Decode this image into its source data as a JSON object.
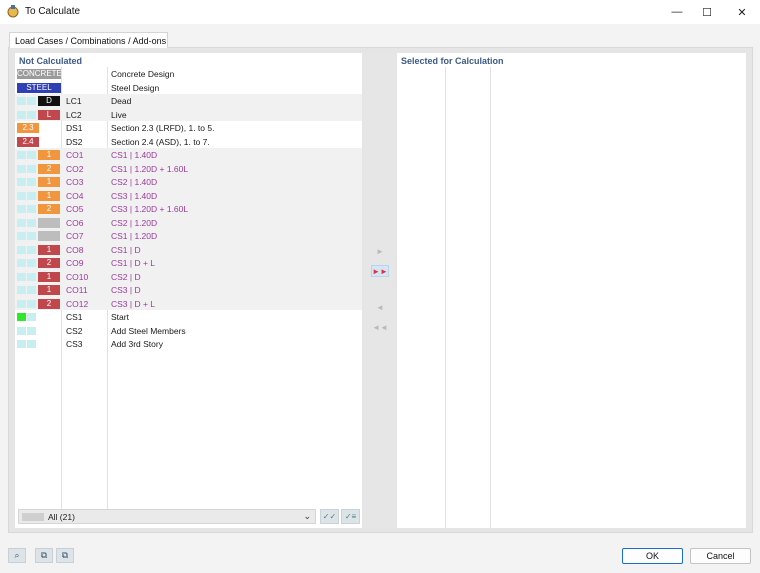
{
  "window": {
    "title": "To Calculate",
    "minimize": "—",
    "maximize": "☐",
    "close": "✕"
  },
  "tab": {
    "label": "Load Cases / Combinations / Add-ons"
  },
  "left_panel": {
    "title": "Not Calculated",
    "rows": [
      {
        "tag": "CONCRETE",
        "tag_color": "#9b9b9b",
        "tag_kind": "wide",
        "sq1": false,
        "sq2": false,
        "id": "",
        "desc": "Concrete Design",
        "purple": false
      },
      {
        "tag": "STEEL",
        "tag_color": "#2f3fb4",
        "tag_kind": "wide",
        "sq1": false,
        "sq2": false,
        "id": "",
        "desc": "Steel Design",
        "purple": false
      },
      {
        "tag": "D",
        "tag_color": "#111111",
        "tag_kind": "col2",
        "sq1": true,
        "sq2": true,
        "id": "LC1",
        "desc": "Dead",
        "purple": false
      },
      {
        "tag": "L",
        "tag_color": "#c0474b",
        "tag_kind": "col2",
        "sq1": true,
        "sq2": true,
        "id": "LC2",
        "desc": "Live",
        "purple": false
      },
      {
        "tag": "2.3",
        "tag_color": "#f0963f",
        "tag_kind": "col1",
        "sq1": false,
        "sq2": false,
        "id": "DS1",
        "desc": "Section 2.3 (LRFD), 1. to 5.",
        "purple": false
      },
      {
        "tag": "2.4",
        "tag_color": "#c0474b",
        "tag_kind": "col1",
        "sq1": false,
        "sq2": false,
        "id": "DS2",
        "desc": "Section 2.4 (ASD), 1. to 7.",
        "purple": false
      },
      {
        "tag": "1",
        "tag_color": "#f0963f",
        "tag_kind": "col2",
        "sq1": true,
        "sq2": true,
        "id": "CO1",
        "desc": "CS1 | 1.40D",
        "purple": true
      },
      {
        "tag": "2",
        "tag_color": "#f0963f",
        "tag_kind": "col2",
        "sq1": true,
        "sq2": true,
        "id": "CO2",
        "desc": "CS1 | 1.20D + 1.60L",
        "purple": true
      },
      {
        "tag": "1",
        "tag_color": "#f0963f",
        "tag_kind": "col2",
        "sq1": true,
        "sq2": true,
        "id": "CO3",
        "desc": "CS2 | 1.40D",
        "purple": true
      },
      {
        "tag": "1",
        "tag_color": "#f0963f",
        "tag_kind": "col2",
        "sq1": true,
        "sq2": true,
        "id": "CO4",
        "desc": "CS3 | 1.40D",
        "purple": true
      },
      {
        "tag": "2",
        "tag_color": "#f0963f",
        "tag_kind": "col2",
        "sq1": true,
        "sq2": true,
        "id": "CO5",
        "desc": "CS3 | 1.20D + 1.60L",
        "purple": true
      },
      {
        "tag": "",
        "tag_color": "#bdbdbd",
        "tag_kind": "col2",
        "sq1": true,
        "sq2": true,
        "id": "CO6",
        "desc": "CS2 | 1.20D",
        "purple": true
      },
      {
        "tag": "",
        "tag_color": "#bdbdbd",
        "tag_kind": "col2",
        "sq1": true,
        "sq2": true,
        "id": "CO7",
        "desc": "CS1 | 1.20D",
        "purple": true
      },
      {
        "tag": "1",
        "tag_color": "#c0474b",
        "tag_kind": "col2",
        "sq1": true,
        "sq2": true,
        "id": "CO8",
        "desc": "CS1 | D",
        "purple": true
      },
      {
        "tag": "2",
        "tag_color": "#c0474b",
        "tag_kind": "col2",
        "sq1": true,
        "sq2": true,
        "id": "CO9",
        "desc": "CS1 | D + L",
        "purple": true
      },
      {
        "tag": "1",
        "tag_color": "#c0474b",
        "tag_kind": "col2",
        "sq1": true,
        "sq2": true,
        "id": "CO10",
        "desc": "CS2 | D",
        "purple": true
      },
      {
        "tag": "1",
        "tag_color": "#c0474b",
        "tag_kind": "col2",
        "sq1": true,
        "sq2": true,
        "id": "CO11",
        "desc": "CS3 | D",
        "purple": true
      },
      {
        "tag": "2",
        "tag_color": "#c0474b",
        "tag_kind": "col2",
        "sq1": true,
        "sq2": true,
        "id": "CO12",
        "desc": "CS3 | D + L",
        "purple": true
      },
      {
        "tag": "",
        "tag_color": "",
        "tag_kind": "none",
        "sq1": "green",
        "sq2": true,
        "id": "CS1",
        "desc": "Start",
        "purple": false
      },
      {
        "tag": "",
        "tag_color": "",
        "tag_kind": "none",
        "sq1": true,
        "sq2": true,
        "id": "CS2",
        "desc": "Add Steel Members",
        "purple": false
      },
      {
        "tag": "",
        "tag_color": "",
        "tag_kind": "none",
        "sq1": true,
        "sq2": true,
        "id": "CS3",
        "desc": "Add 3rd Story",
        "purple": false
      }
    ],
    "filter": {
      "value": "All (21)"
    }
  },
  "right_panel": {
    "title": "Selected for Calculation"
  },
  "arrows": {
    "add_one": "►",
    "add_all": "►►",
    "remove_one": "◄",
    "remove_all": "◄◄"
  },
  "select_buttons": {
    "select_all": "✓✓",
    "deselect_all": "✓≡"
  },
  "toolbar": {
    "icon1": "⌕",
    "icon2": "⧉",
    "icon3": "⧉"
  },
  "buttons": {
    "ok": "OK",
    "cancel": "Cancel"
  }
}
